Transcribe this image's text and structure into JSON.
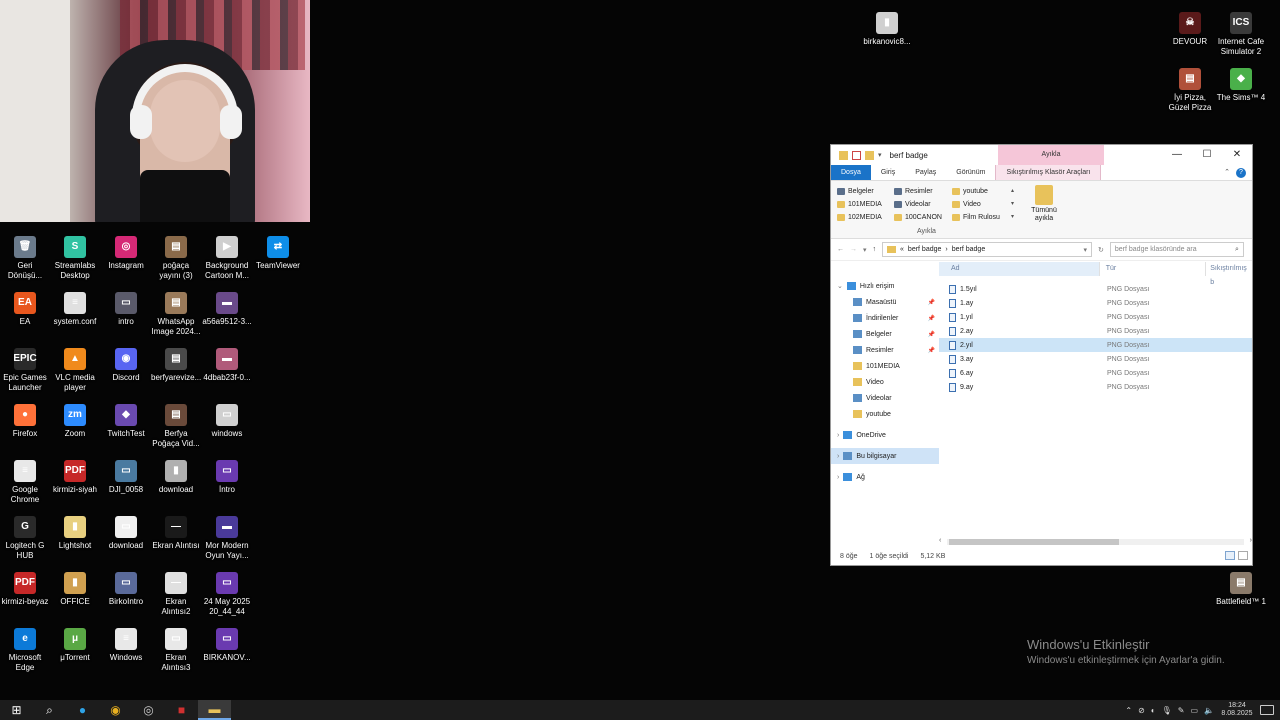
{
  "desktop": {
    "left_icons": [
      {
        "label": "Geri\nDönüşü...",
        "glyph": "🗑",
        "color": "#6b7b8c"
      },
      {
        "label": "Streamlabs\nDesktop",
        "glyph": "S",
        "color": "#31c3a2"
      },
      {
        "label": "Instagram",
        "glyph": "◎",
        "color": "#d62976"
      },
      {
        "label": "poğaça\nyayını (3)",
        "glyph": "▤",
        "color": "#8a6a4a"
      },
      {
        "label": "Background\nCartoon M...",
        "glyph": "▶",
        "color": "#cfcfcf"
      },
      {
        "label": "TeamViewer",
        "glyph": "⇄",
        "color": "#0e8ee9"
      },
      {
        "label": "EA",
        "glyph": "EA",
        "color": "#e8571e"
      },
      {
        "label": "system.conf",
        "glyph": "≡",
        "color": "#e0e0e0"
      },
      {
        "label": "intro",
        "glyph": "▭",
        "color": "#5a5a6a"
      },
      {
        "label": "WhatsApp\nImage 2024...",
        "glyph": "▤",
        "color": "#9a7a5a"
      },
      {
        "label": "a56a9512-3...",
        "glyph": "▬",
        "color": "#6a4a8a"
      },
      {
        "label": "Epic Games\nLauncher",
        "glyph": "EPIC",
        "color": "#2a2a2a"
      },
      {
        "label": "VLC media\nplayer",
        "glyph": "▲",
        "color": "#f08a1c"
      },
      {
        "label": "Discord",
        "glyph": "◉",
        "color": "#5865f2"
      },
      {
        "label": "berfyarevize...",
        "glyph": "▤",
        "color": "#4a4a4a"
      },
      {
        "label": "4dbab23f-0...",
        "glyph": "▬",
        "color": "#b05a7a"
      },
      {
        "label": "Firefox",
        "glyph": "●",
        "color": "#ff7139"
      },
      {
        "label": "Zoom",
        "glyph": "zm",
        "color": "#2d8cff"
      },
      {
        "label": "TwitchTest",
        "glyph": "◆",
        "color": "#6a4ab0"
      },
      {
        "label": "Berfya\nPoğaça Vid...",
        "glyph": "▤",
        "color": "#6a4a3a"
      },
      {
        "label": "windows",
        "glyph": "▭",
        "color": "#d0d0d0"
      },
      {
        "label": "Google\nChrome",
        "glyph": "≡",
        "color": "#e8e8e8"
      },
      {
        "label": "kirmizi-siyah",
        "glyph": "PDF",
        "color": "#c62828"
      },
      {
        "label": "DJI_0058",
        "glyph": "▭",
        "color": "#4a7aa0"
      },
      {
        "label": "download",
        "glyph": "▮",
        "color": "#b0b0b0"
      },
      {
        "label": "İntro",
        "glyph": "▭",
        "color": "#6a3ab0"
      },
      {
        "label": "Logitech G\nHUB",
        "glyph": "G",
        "color": "#2a2a2a"
      },
      {
        "label": "Lightshot",
        "glyph": "▮",
        "color": "#e8d080"
      },
      {
        "label": "download",
        "glyph": "▭",
        "color": "#f0f0f0"
      },
      {
        "label": "Ekran Alıntısı",
        "glyph": "—",
        "color": "#1a1a1a"
      },
      {
        "label": "Mor Modern\nOyun Yayı...",
        "glyph": "▬",
        "color": "#4a3a9a"
      },
      {
        "label": "kirmizi-beyaz",
        "glyph": "PDF",
        "color": "#c62828"
      },
      {
        "label": "OFFICE",
        "glyph": "▮",
        "color": "#d0a050"
      },
      {
        "label": "BirkoIntro",
        "glyph": "▭",
        "color": "#5a6a9a"
      },
      {
        "label": "Ekran\nAlıntısı2",
        "glyph": "—",
        "color": "#e0e0e0"
      },
      {
        "label": "24 May 2025\n20_44_44",
        "glyph": "▭",
        "color": "#6a3ab0"
      },
      {
        "label": "Microsoft\nEdge",
        "glyph": "e",
        "color": "#0c7ad8"
      },
      {
        "label": "μTorrent",
        "glyph": "μ",
        "color": "#5aa845"
      },
      {
        "label": "Windows",
        "glyph": "≡",
        "color": "#e8e8e8"
      },
      {
        "label": "Ekran\nAlıntısı3",
        "glyph": "▭",
        "color": "#e8e8e8"
      },
      {
        "label": "BIRKANOV...",
        "glyph": "▭",
        "color": "#6a3ab0"
      }
    ],
    "right_icons": [
      {
        "label": "birkanovic8...",
        "glyph": "▮",
        "color": "#d0d0d0"
      },
      {
        "label": "DEVOUR",
        "glyph": "☠",
        "color": "#5a1a1a"
      },
      {
        "label": "Internet Cafe\nSimulator 2",
        "glyph": "ICS",
        "color": "#3a3a3a"
      },
      {
        "label": "İyi Pizza,\nGüzel Pizza",
        "glyph": "▤",
        "color": "#b0503a"
      },
      {
        "label": "The Sims™ 4",
        "glyph": "◆",
        "color": "#4ab04a"
      },
      {
        "label": "Battlefield™ 1",
        "glyph": "▤",
        "color": "#8a7a6a"
      }
    ]
  },
  "explorer": {
    "title": "berf badge",
    "context_tab_top": "Ayıkla",
    "window_controls": {
      "minimize": "—",
      "maximize": "☐",
      "close": "✕"
    },
    "ribbon_tabs": [
      "Dosya",
      "Giriş",
      "Paylaş",
      "Görünüm",
      "Sıkıştırılmış Klasör Araçları"
    ],
    "help": "?",
    "ribbon_items": [
      {
        "label": "Belgeler",
        "icon": "documents-icon"
      },
      {
        "label": "Resimler",
        "icon": "pictures-icon"
      },
      {
        "label": "youtube",
        "icon": "folder-icon"
      },
      {
        "label": "101MEDIA",
        "icon": "folder-icon"
      },
      {
        "label": "Videolar",
        "icon": "videos-icon"
      },
      {
        "label": "Video",
        "icon": "folder-icon"
      },
      {
        "label": "102MEDIA",
        "icon": "folder-icon"
      },
      {
        "label": "100CANON",
        "icon": "folder-icon"
      },
      {
        "label": "Film Rulosu",
        "icon": "folder-icon"
      }
    ],
    "extract_all": "Tümünü\nayıkla",
    "ribbon_group": "Ayıkla",
    "address": {
      "prefix": "«",
      "parts": [
        "berf badge",
        "berf badge"
      ]
    },
    "search_placeholder": "berf badge klasöründe ara",
    "nav": [
      {
        "label": "Hızlı erişim",
        "icon": "star-icon",
        "type": "header"
      },
      {
        "label": "Masaüstü",
        "icon": "desktop-icon",
        "pinned": true
      },
      {
        "label": "İndirilenler",
        "icon": "downloads-icon",
        "pinned": true
      },
      {
        "label": "Belgeler",
        "icon": "documents-icon",
        "pinned": true
      },
      {
        "label": "Resimler",
        "icon": "pictures-icon",
        "pinned": true
      },
      {
        "label": "101MEDIA",
        "icon": "folder-icon"
      },
      {
        "label": "Video",
        "icon": "folder-icon"
      },
      {
        "label": "Videolar",
        "icon": "videos-icon"
      },
      {
        "label": "youtube",
        "icon": "folder-icon"
      },
      {
        "label": "OneDrive",
        "icon": "cloud-icon",
        "type": "root"
      },
      {
        "label": "Bu bilgisayar",
        "icon": "pc-icon",
        "type": "root",
        "selected": true
      },
      {
        "label": "Ağ",
        "icon": "network-icon",
        "type": "root"
      }
    ],
    "columns": {
      "name": "Ad",
      "type": "Tür",
      "compressed": "Sıkıştırılmış b"
    },
    "files": [
      {
        "name": "1.5yıl",
        "type": "PNG Dosyası"
      },
      {
        "name": "1.ay",
        "type": "PNG Dosyası"
      },
      {
        "name": "1.yıl",
        "type": "PNG Dosyası"
      },
      {
        "name": "2.ay",
        "type": "PNG Dosyası"
      },
      {
        "name": "2.yıl",
        "type": "PNG Dosyası",
        "selected": true
      },
      {
        "name": "3.ay",
        "type": "PNG Dosyası"
      },
      {
        "name": "6.ay",
        "type": "PNG Dosyası"
      },
      {
        "name": "9.ay",
        "type": "PNG Dosyası"
      }
    ],
    "status": {
      "count": "8 öğe",
      "selection": "1 öğe seçildi",
      "size": "5,12 KB"
    }
  },
  "watermark": {
    "title": "Windows'u Etkinleştir",
    "subtitle": "Windows'u etkinleştirmek için Ayarlar'a gidin."
  },
  "taskbar": {
    "clock_time": "18:24",
    "clock_date": "8.08.2025"
  }
}
